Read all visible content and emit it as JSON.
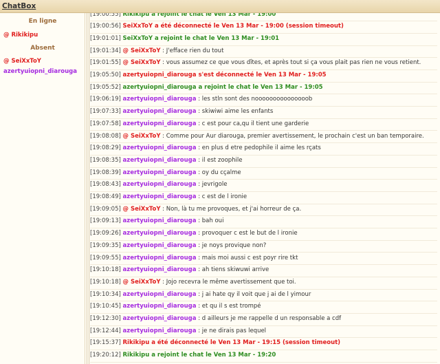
{
  "window": {
    "title": "ChatBox"
  },
  "sidebar": {
    "online_label": "En ligne",
    "online_users": [
      {
        "name": "@ Rikikipu",
        "color": "red"
      }
    ],
    "away_label": "Absent",
    "away_users": [
      {
        "name": "@ SeiXxToY",
        "color": "red"
      },
      {
        "name": "azertyuiopni_diarouga",
        "color": "purple"
      }
    ]
  },
  "colors": {
    "admin": "#e01c1c",
    "user": "#a52ae0",
    "join": "#2c8c1f",
    "header": "#9c6b3a"
  },
  "messages": [
    {
      "type": "join",
      "time": "[19:00:55]",
      "text": "Rikikipu a rejoint le chat le Ven 13 Mar - 19:00"
    },
    {
      "type": "leave",
      "time": "[19:00:56]",
      "text": "SeiXxToY a été déconnecté le Ven 13 Mar - 19:00 (session timeout)"
    },
    {
      "type": "join",
      "time": "[19:01:01]",
      "text": "SeiXxToY a rejoint le chat le Ven 13 Mar - 19:01"
    },
    {
      "type": "msg",
      "time": "[19:01:34]",
      "nick": "@ SeiXxToY",
      "role": "admin",
      "text": " : J'efface rien du tout"
    },
    {
      "type": "msg",
      "time": "[19:01:55]",
      "nick": "@ SeiXxToY",
      "role": "admin",
      "text": " : vous assumez ce que vous dîtes, et après tout si ça vous plait pas rien ne vous retient."
    },
    {
      "type": "leave",
      "time": "[19:05:50]",
      "text": "azertyuiopni_diarouga s'est déconnecté le Ven 13 Mar - 19:05"
    },
    {
      "type": "join",
      "time": "[19:05:52]",
      "text": "azertyuiopni_diarouga a rejoint le chat le Ven 13 Mar - 19:05"
    },
    {
      "type": "msg",
      "time": "[19:06:19]",
      "nick": "azertyuiopni_diarouga",
      "role": "user",
      "text": " : les stln sont des nooooooooooooooob"
    },
    {
      "type": "msg",
      "time": "[19:07:33]",
      "nick": "azertyuiopni_diarouga",
      "role": "user",
      "text": " : skiwiwi aime les enfants"
    },
    {
      "type": "msg",
      "time": "[19:07:58]",
      "nick": "azertyuiopni_diarouga",
      "role": "user",
      "text": " : c est pour ca,qu il tient une garderie"
    },
    {
      "type": "msg",
      "time": "[19:08:08]",
      "nick": "@ SeiXxToY",
      "role": "admin",
      "text": " : Comme pour Aur diarouga, premier avertissement, le prochain c'est un ban temporaire."
    },
    {
      "type": "msg",
      "time": "[19:08:29]",
      "nick": "azertyuiopni_diarouga",
      "role": "user",
      "text": " : en plus d etre pedophile il aime les rçats"
    },
    {
      "type": "msg",
      "time": "[19:08:35]",
      "nick": "azertyuiopni_diarouga",
      "role": "user",
      "text": " : il est zoophile"
    },
    {
      "type": "msg",
      "time": "[19:08:39]",
      "nick": "azertyuiopni_diarouga",
      "role": "user",
      "text": " : oy du cçalme"
    },
    {
      "type": "msg",
      "time": "[19:08:43]",
      "nick": "azertyuiopni_diarouga",
      "role": "user",
      "text": " : jevrigole"
    },
    {
      "type": "msg",
      "time": "[19:08:49]",
      "nick": "azertyuiopni_diarouga",
      "role": "user",
      "text": " : c est de l ironie"
    },
    {
      "type": "msg",
      "time": "[19:09:05]",
      "nick": "@ SeiXxToY",
      "role": "admin",
      "text": " : Non, là tu me provoques, et j'ai horreur de ça."
    },
    {
      "type": "msg",
      "time": "[19:09:13]",
      "nick": "azertyuiopni_diarouga",
      "role": "user",
      "text": " : bah oui"
    },
    {
      "type": "msg",
      "time": "[19:09:26]",
      "nick": "azertyuiopni_diarouga",
      "role": "user",
      "text": " : provoquer c est le but de l ironie"
    },
    {
      "type": "msg",
      "time": "[19:09:35]",
      "nick": "azertyuiopni_diarouga",
      "role": "user",
      "text": " : je noys provique non?"
    },
    {
      "type": "msg",
      "time": "[19:09:55]",
      "nick": "azertyuiopni_diarouga",
      "role": "user",
      "text": " : mais moi aussi c est poyr rire tkt"
    },
    {
      "type": "msg",
      "time": "[19:10:18]",
      "nick": "azertyuiopni_diarouga",
      "role": "user",
      "text": " : ah tiens skiwuwi arrive"
    },
    {
      "type": "msg",
      "time": "[19:10:18]",
      "nick": "@ SeiXxToY",
      "role": "admin",
      "text": " : Jojo recevra le même avertissement que toi."
    },
    {
      "type": "msg",
      "time": "[19:10:34]",
      "nick": "azertyuiopni_diarouga",
      "role": "user",
      "text": " : j ai hate qy il voit que j ai de l yimour"
    },
    {
      "type": "msg",
      "time": "[19:10:45]",
      "nick": "azertyuiopni_diarouga",
      "role": "user",
      "text": " : et qu il s est trompé"
    },
    {
      "type": "msg",
      "time": "[19:12:30]",
      "nick": "azertyuiopni_diarouga",
      "role": "user",
      "text": " : d ailleurs je me rappelle d un responsable a cdf"
    },
    {
      "type": "msg",
      "time": "[19:12:44]",
      "nick": "azertyuiopni_diarouga",
      "role": "user",
      "text": " : je ne dirais pas lequel"
    },
    {
      "type": "leave",
      "time": "[19:15:37]",
      "text": "Rikikipu a été déconnecté le Ven 13 Mar - 19:15 (session timeout)"
    },
    {
      "type": "join",
      "time": "[19:20:12]",
      "text": "Rikikipu a rejoint le chat le Ven 13 Mar - 19:20"
    }
  ]
}
